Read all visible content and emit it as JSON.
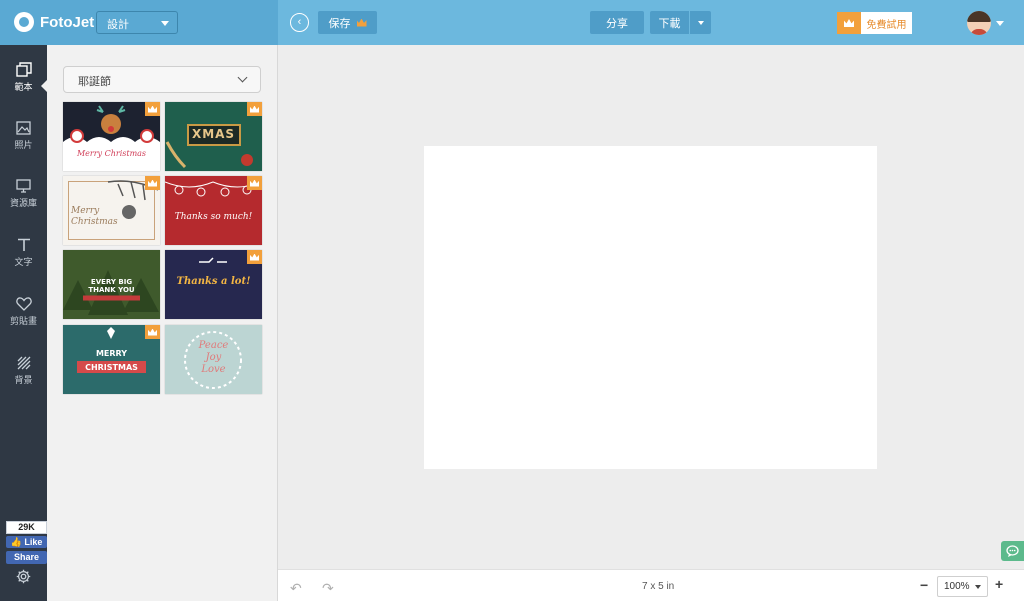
{
  "app": {
    "name": "FotoJet"
  },
  "header": {
    "mode": "設計",
    "save_label": "保存",
    "share_label": "分享",
    "download_label": "下載",
    "trial_label": "免費試用"
  },
  "sidebar": {
    "items": [
      {
        "label": "範本",
        "icon": "template-icon"
      },
      {
        "label": "照片",
        "icon": "photo-icon"
      },
      {
        "label": "資源庫",
        "icon": "monitor-icon"
      },
      {
        "label": "文字",
        "icon": "text-icon"
      },
      {
        "label": "剪貼畫",
        "icon": "heart-icon"
      },
      {
        "label": "背景",
        "icon": "pattern-icon"
      }
    ],
    "fb_count": "29K",
    "fb_like": "Like",
    "fb_share": "Share"
  },
  "panel": {
    "category": "耶誕節",
    "templates": [
      {
        "text": "Merry Christmas",
        "premium": true
      },
      {
        "text": "XMAS",
        "premium": true
      },
      {
        "text": "Merry Christmas",
        "premium": true
      },
      {
        "text": "Thanks so much!",
        "premium": true
      },
      {
        "text": "EVERY BIG THANK YOU",
        "premium": false
      },
      {
        "text": "Thanks a lot!",
        "premium": true
      },
      {
        "text": "MERRY CHRISTMAS",
        "premium": true
      },
      {
        "text": "Peace Joy Love",
        "premium": false
      }
    ]
  },
  "footer": {
    "size": "7 x 5 in",
    "zoom": "100%"
  },
  "colors": {
    "header": "#6cb8de",
    "sidebar": "#2f3844",
    "accent": "#f2a03c"
  }
}
